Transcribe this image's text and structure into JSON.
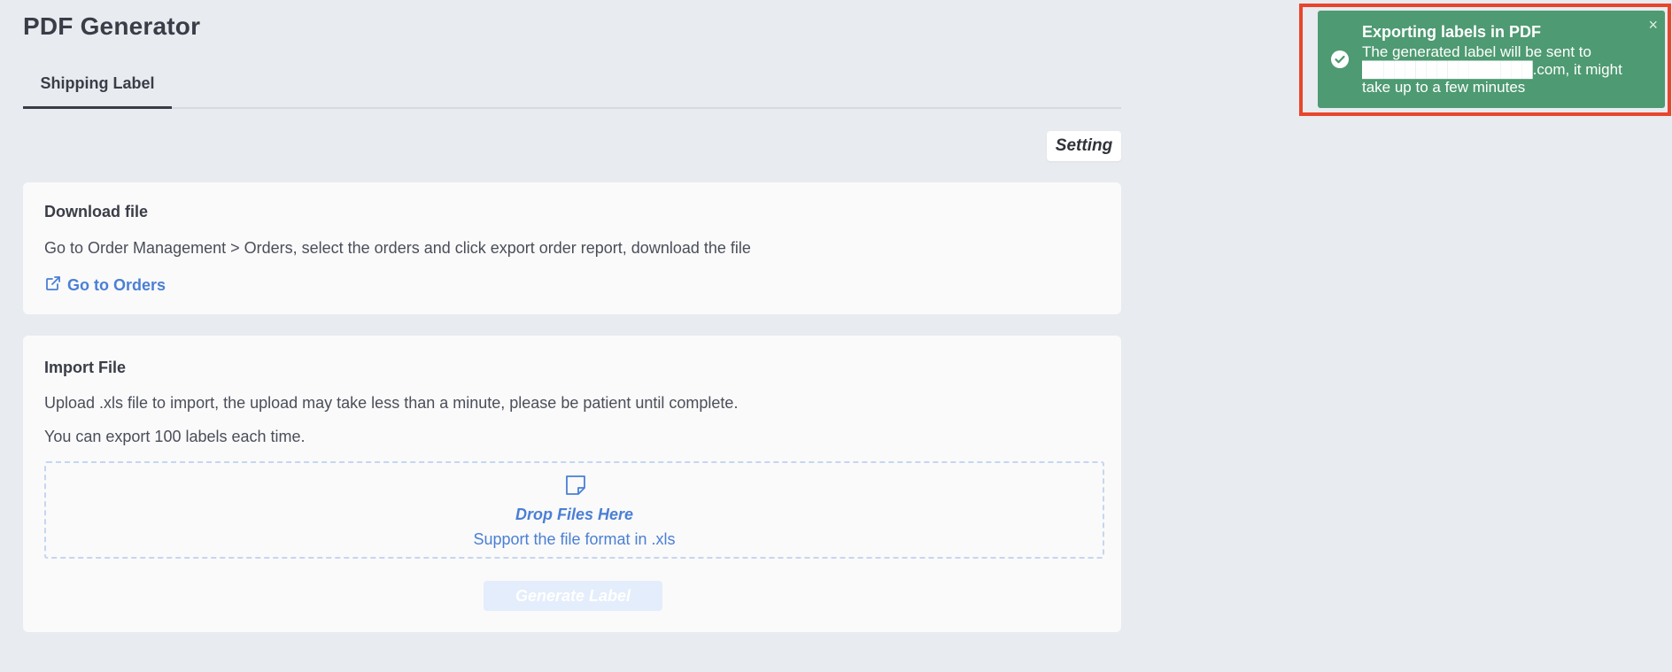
{
  "page": {
    "title": "PDF Generator"
  },
  "tabs": [
    {
      "label": "Shipping Label",
      "active": true
    }
  ],
  "toolbar": {
    "setting_label": "Setting"
  },
  "download_card": {
    "title": "Download file",
    "description": "Go to Order Management > Orders, select the orders and click export order report, download the file",
    "link_label": "Go to Orders",
    "link_icon": "external-link-icon"
  },
  "import_card": {
    "title": "Import File",
    "description": "Upload .xls file to import, the upload may take less than a minute, please be patient until complete.",
    "limit_note": "You can export 100 labels each time.",
    "dropzone": {
      "icon": "file-note-icon",
      "title": "Drop Files Here",
      "subtitle": "Support the file format in .xls"
    },
    "generate_label": "Generate Label",
    "generate_disabled": true
  },
  "toast": {
    "title": "Exporting labels in PDF",
    "body": "The generated label will be sent to ████████████████.com, it might take up to a few minutes",
    "icon": "check-circle-icon",
    "close_icon": "close-icon",
    "close_label": "×",
    "color": "#4e9a72",
    "highlight_color": "#e8452c"
  },
  "colors": {
    "background": "#e8ebef",
    "accent": "#4a7fd6",
    "text": "#3a3d47"
  }
}
